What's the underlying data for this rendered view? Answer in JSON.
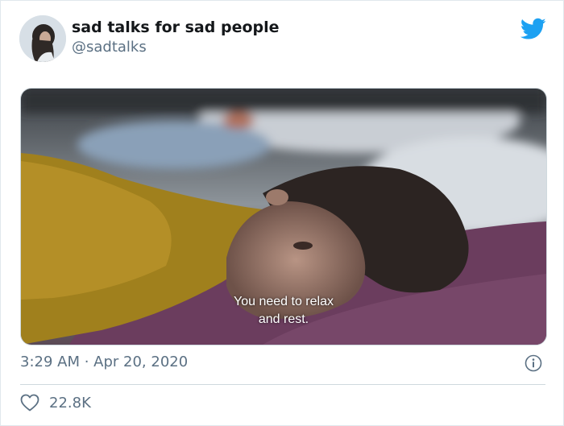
{
  "tweet": {
    "display_name": "sad talks for sad people",
    "handle": "@sadtalks",
    "timestamp": "3:29 AM · Apr 20, 2020",
    "likes": "22.8K",
    "media": {
      "subtitle_line1": "You need to relax",
      "subtitle_line2": "and rest."
    }
  },
  "icons": {
    "platform": "twitter-bird-icon",
    "info": "info-icon",
    "like": "heart-icon"
  },
  "colors": {
    "brand": "#1da1f2",
    "secondary_text": "#5b7083",
    "primary_text": "#14171a"
  }
}
